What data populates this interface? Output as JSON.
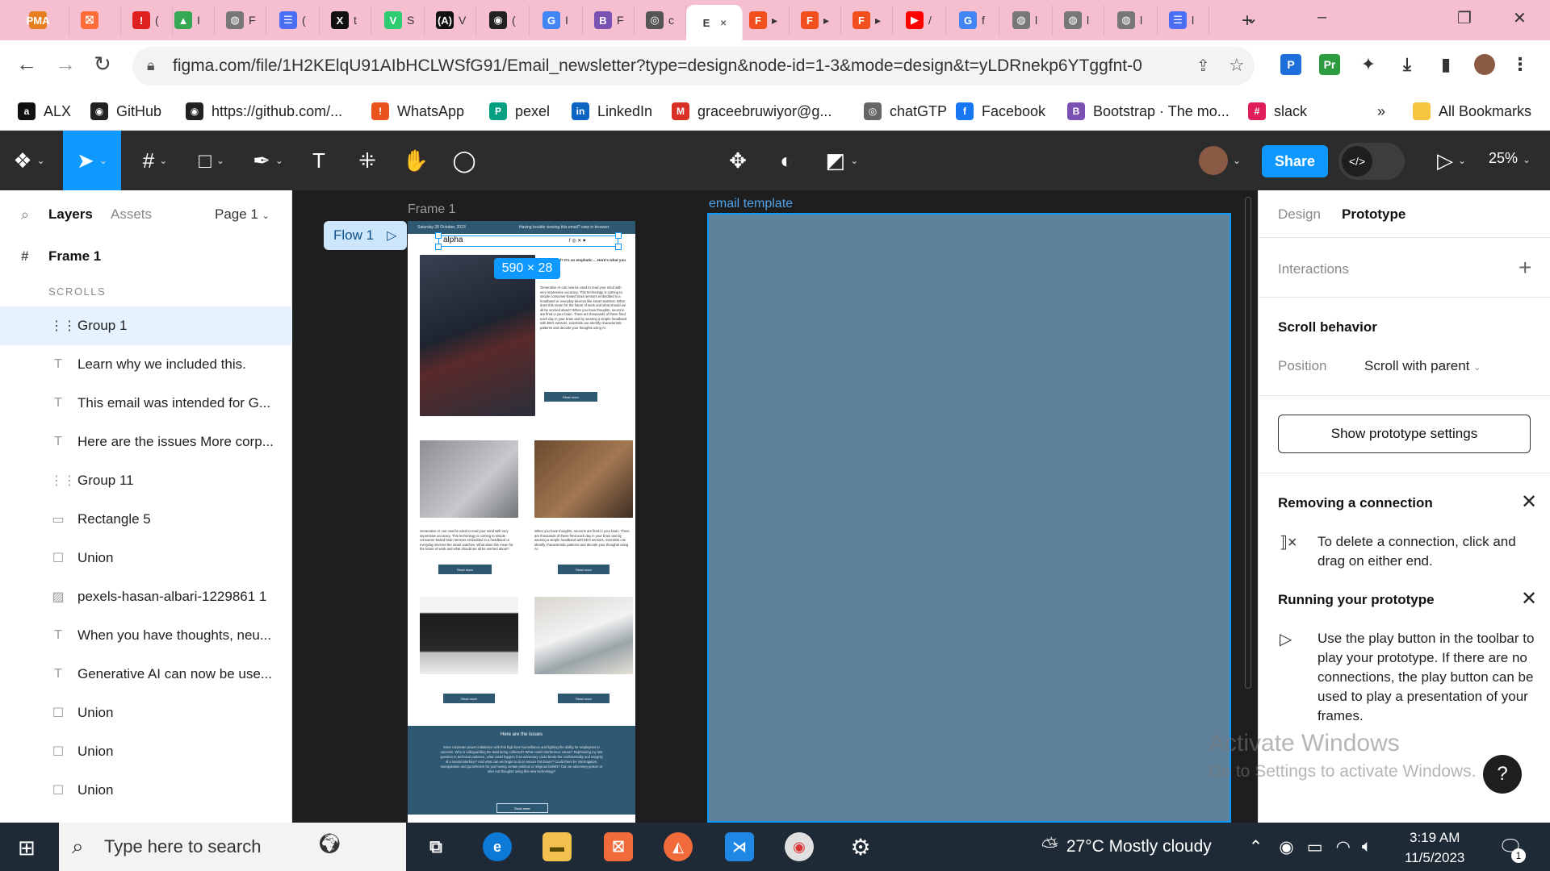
{
  "browser": {
    "tabs": [
      {
        "icon": "pma-icon",
        "letter": "PMA",
        "color": "#e67e22",
        "text": ""
      },
      {
        "icon": "postman-icon",
        "letter": "⛝",
        "color": "#ff6c37",
        "text": ""
      },
      {
        "icon": "alert-icon",
        "letter": "!",
        "color": "#e02020",
        "text": "("
      },
      {
        "icon": "drive-icon",
        "letter": "▲",
        "color": "#34a853",
        "text": "I"
      },
      {
        "icon": "globe-icon",
        "letter": "◍",
        "color": "#777777",
        "text": "F"
      },
      {
        "icon": "docs-icon",
        "letter": "☰",
        "color": "#4c6ef5",
        "text": "("
      },
      {
        "icon": "x-icon",
        "letter": "X",
        "color": "#111111",
        "text": "t"
      },
      {
        "icon": "vuetify-icon",
        "letter": "V",
        "color": "#2ecc71",
        "text": "S"
      },
      {
        "icon": "alx-icon",
        "letter": "(A)",
        "color": "#111111",
        "text": "V"
      },
      {
        "icon": "github-icon",
        "letter": "◉",
        "color": "#222222",
        "text": "("
      },
      {
        "icon": "google-icon",
        "letter": "G",
        "color": "#4285f4",
        "text": "I"
      },
      {
        "icon": "bootstrap-icon",
        "letter": "B",
        "color": "#7952b3",
        "text": "F"
      },
      {
        "icon": "chatgpt-icon",
        "letter": "◎",
        "color": "#555555",
        "text": "c"
      },
      {
        "icon": "figma-tab-icon",
        "letter": "E",
        "color": "#ffffff",
        "text": "×"
      },
      {
        "icon": "figma-icon",
        "letter": "F",
        "color": "#f24e1e",
        "text": "▸"
      },
      {
        "icon": "figma-icon",
        "letter": "F",
        "color": "#f24e1e",
        "text": "▸"
      },
      {
        "icon": "figma-icon",
        "letter": "F",
        "color": "#f24e1e",
        "text": "▸"
      },
      {
        "icon": "youtube-icon",
        "letter": "▶",
        "color": "#ff0000",
        "text": "/"
      },
      {
        "icon": "google-icon",
        "letter": "G",
        "color": "#4285f4",
        "text": "f"
      },
      {
        "icon": "globe-icon",
        "letter": "◍",
        "color": "#777777",
        "text": "l"
      },
      {
        "icon": "globe-icon",
        "letter": "◍",
        "color": "#777777",
        "text": "l"
      },
      {
        "icon": "globe-icon",
        "letter": "◍",
        "color": "#777777",
        "text": "l"
      },
      {
        "icon": "docs-icon",
        "letter": "☰",
        "color": "#4c6ef5",
        "text": "l"
      }
    ],
    "new_tab": "+",
    "window_controls": [
      "⌄",
      "–",
      "❐",
      "✕"
    ],
    "url": "figma.com/file/1H2KElqU91AIbHCLWSfG91/Email_newsletter?type=design&node-id=1-3&mode=design&t=yLDRnekp6YTggfnt-0",
    "bookmarks": [
      {
        "label": "ALX",
        "icon": "alx-icon",
        "color": "#111111",
        "glyph": "a"
      },
      {
        "label": "GitHub",
        "icon": "github-icon",
        "color": "#222222",
        "glyph": "◉"
      },
      {
        "label": "https://github.com/...",
        "icon": "github-icon",
        "color": "#222222",
        "glyph": "◉"
      },
      {
        "label": "WhatsApp",
        "icon": "whatsapp-icon",
        "color": "#e8541c",
        "glyph": "!"
      },
      {
        "label": "pexel",
        "icon": "pexels-icon",
        "color": "#05a081",
        "glyph": "P"
      },
      {
        "label": "LinkedIn",
        "icon": "linkedin-icon",
        "color": "#0a66c2",
        "glyph": "in"
      },
      {
        "label": "graceebruwiyor@g...",
        "icon": "gmail-icon",
        "color": "#d93025",
        "glyph": "M"
      },
      {
        "label": "chatGTP",
        "icon": "chatgpt-icon",
        "color": "#666666",
        "glyph": "◎"
      },
      {
        "label": "Facebook",
        "icon": "facebook-icon",
        "color": "#1877f2",
        "glyph": "f"
      },
      {
        "label": "Bootstrap · The mo...",
        "icon": "bootstrap-icon",
        "color": "#7952b3",
        "glyph": "B"
      },
      {
        "label": "slack",
        "icon": "slack-icon",
        "color": "#e01e5a",
        "glyph": "#"
      }
    ],
    "bookmarks_more": "»",
    "all_bookmarks": "All Bookmarks"
  },
  "figma": {
    "share_label": "Share",
    "zoom": "25%",
    "left_panel": {
      "tab_layers": "Layers",
      "tab_assets": "Assets",
      "page": "Page 1",
      "frame": "Frame 1",
      "section": "SCROLLS",
      "layers": [
        {
          "label": "Group 1",
          "icon": "group-icon",
          "glyph": "⋮⋮",
          "selected": true
        },
        {
          "label": "Learn why we included this.",
          "icon": "text-icon",
          "glyph": "T"
        },
        {
          "label": "This email was intended for G...",
          "icon": "text-icon",
          "glyph": "T"
        },
        {
          "label": "Here are the issues More corp...",
          "icon": "text-icon",
          "glyph": "T"
        },
        {
          "label": "Group 11",
          "icon": "group-icon",
          "glyph": "⋮⋮"
        },
        {
          "label": "Rectangle 5",
          "icon": "rectangle-icon",
          "glyph": "▭"
        },
        {
          "label": "Union",
          "icon": "union-icon",
          "glyph": "☐"
        },
        {
          "label": "pexels-hasan-albari-1229861 1",
          "icon": "image-icon",
          "glyph": "▨"
        },
        {
          "label": "When you have thoughts, neu...",
          "icon": "text-icon",
          "glyph": "T"
        },
        {
          "label": "Generative AI can now be use...",
          "icon": "text-icon",
          "glyph": "T"
        },
        {
          "label": "Union",
          "icon": "union-icon",
          "glyph": "☐"
        },
        {
          "label": "Union",
          "icon": "union-icon",
          "glyph": "☐"
        },
        {
          "label": "Union",
          "icon": "union-icon",
          "glyph": "☐"
        }
      ]
    },
    "canvas": {
      "frame1_label": "Frame 1",
      "flow_label": "Flow 1",
      "dimension_badge": "590 × 28",
      "email_template_label": "email template",
      "email": {
        "date": "Saturday 28 October, 2023",
        "trouble": "Having trouble viewing this email? view in browser",
        "logo": "alpha",
        "social": "f ◎ ✕ ♥",
        "headline": "...your mind? It's an emphatic ... Here's what you should",
        "body1": "Generative AI can now be used to read your mind with very impressive accuracy. This technology is coming to simple consumer-based brain sensors embedded in a headband or everyday devices like smart watches. What does this mean for the future of work and what should we all be worried about? When you have thoughts, neurons are fired in your brain. There are thousands of these fired each day in your brain and by wearing a simple headband with EEG sensors, scientists can identify characteristic patterns and decode your thoughts using AI.",
        "read_more": "Read more",
        "col_text_left": "Generative AI can now be used to read your mind with very impressive accuracy. This technology is coming to simple consumer-based brain sensors embedded in a headband or everyday devices like smart watches. What does this mean for the future of work and what should we all be worried about?",
        "col_text_right": "When you have thoughts, neurons are fired in your brain. There are thousands of these fired each day in your brain and by wearing a simple headband with EEG sensors, scientists can identify characteristic patterns and decode your thoughts using AI.",
        "issues_title": "Here are the issues",
        "issues_body": "More corporate power imbalance with this high level surveillance and fighting the ability for employees to unionize. Who is safeguarding the data being collected? What could interference cause? Rephrasing my last question in technical parlance, what could happen if an adversary could break the confidentiality and integrity of a neural interface? And what can we begin to do to secure this future? Could there be interrogation, manipulation and punishment for just having certain political or religious beliefs? Can an adversary poison or alter our thoughts using this new technology?"
      }
    },
    "right_panel": {
      "tab_design": "Design",
      "tab_prototype": "Prototype",
      "interactions": "Interactions",
      "add": "+",
      "scroll_behavior": "Scroll behavior",
      "position_label": "Position",
      "position_value": "Scroll with parent",
      "show_proto_settings": "Show prototype settings",
      "removing_title": "Removing a connection",
      "removing_body": "To delete a connection, click and drag on either end.",
      "running_title": "Running your prototype",
      "running_body": "Use the play button in the toolbar to play your prototype. If there are no connections, the play button can be used to play a presentation of your frames."
    },
    "watermark_title": "Activate Windows",
    "watermark_sub": "Go to Settings to activate Windows.",
    "help": "?"
  },
  "taskbar": {
    "search_placeholder": "Type here to search",
    "weather": "27°C  Mostly cloudy",
    "time": "3:19 AM",
    "date": "11/5/2023",
    "notifications": "1"
  },
  "colors": {
    "accent": "#0d99ff",
    "email_blue": "#2f5873",
    "template_fill": "#5f8199",
    "tab_strip": "#f5bfd0"
  }
}
